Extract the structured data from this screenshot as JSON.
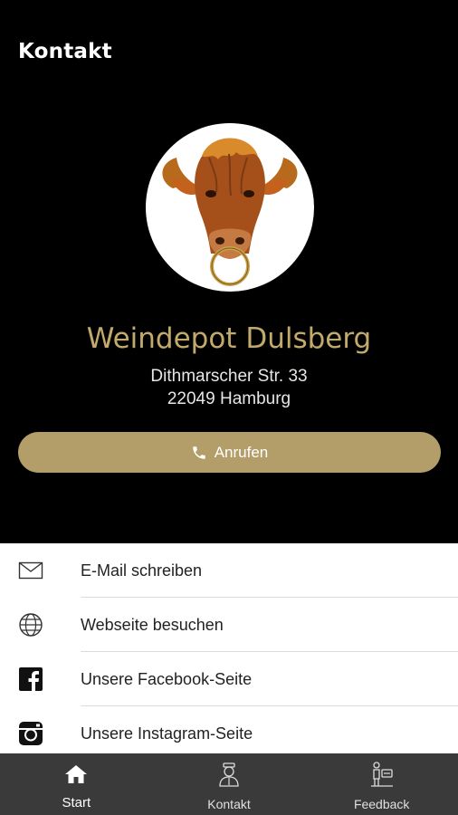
{
  "header": {
    "title": "Kontakt"
  },
  "business": {
    "name": "Weindepot Dulsberg",
    "street": "Dithmarscher Str. 33",
    "city": "22049 Hamburg",
    "logo_icon": "bull-head-logo"
  },
  "call_button": {
    "label": "Anrufen",
    "icon": "phone-icon"
  },
  "actions": [
    {
      "label": "E-Mail schreiben",
      "icon": "mail-icon"
    },
    {
      "label": "Webseite besuchen",
      "icon": "globe-icon"
    },
    {
      "label": "Unsere Facebook-Seite",
      "icon": "facebook-icon"
    },
    {
      "label": "Unsere Instagram-Seite",
      "icon": "instagram-icon"
    }
  ],
  "tabs": [
    {
      "label": "Start",
      "icon": "home-icon",
      "active": true
    },
    {
      "label": "Kontakt",
      "icon": "contact-person-icon",
      "active": false
    },
    {
      "label": "Feedback",
      "icon": "feedback-icon",
      "active": false
    }
  ],
  "colors": {
    "accent": "#b39d68",
    "accent_text": "#c2a96c",
    "background": "#000000",
    "tabbar": "#3a3a3a"
  }
}
